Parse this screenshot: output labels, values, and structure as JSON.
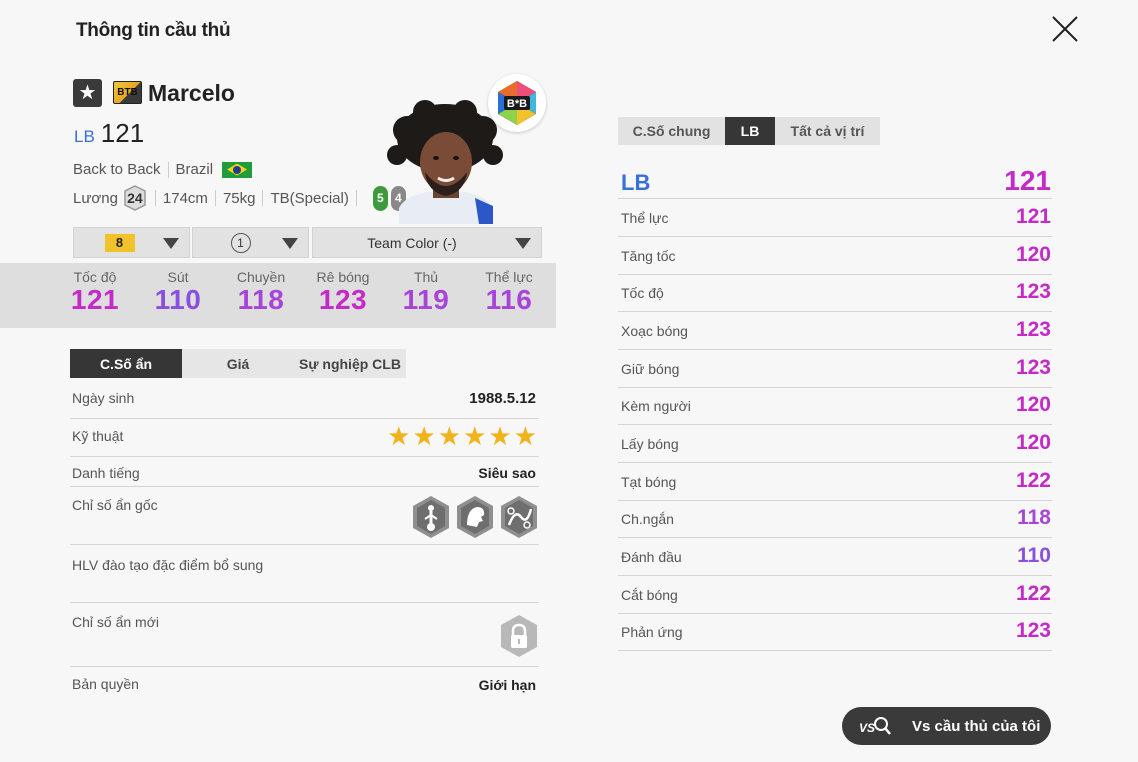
{
  "header": {
    "title": "Thông tin cầu thủ"
  },
  "player": {
    "season_code": "BTB",
    "name": "Marcelo",
    "position": "LB",
    "ovr": "121",
    "season_name": "Back to Back",
    "nationality": "Brazil",
    "salary_label": "Lương",
    "salary": "24",
    "height": "174cm",
    "weight": "75kg",
    "body_type": "TB(Special)",
    "left_foot": "5",
    "right_foot": "4"
  },
  "controls": {
    "grade": "8",
    "level": "1",
    "team_color": "Team Color (-)"
  },
  "main_stats": [
    {
      "label": "Tốc độ",
      "value": "121"
    },
    {
      "label": "Sút",
      "value": "110"
    },
    {
      "label": "Chuyền",
      "value": "118"
    },
    {
      "label": "Rê bóng",
      "value": "123"
    },
    {
      "label": "Thủ",
      "value": "119"
    },
    {
      "label": "Thể lực",
      "value": "116"
    }
  ],
  "left_tabs": [
    "C.Số ẩn",
    "Giá",
    "Sự nghiệp CLB"
  ],
  "info": {
    "birth_label": "Ngày sinh",
    "birth": "1988.5.12",
    "skill_label": "Kỹ thuật",
    "skill_stars": 6,
    "reputation_label": "Danh tiếng",
    "reputation": "Siêu sao",
    "traits_label": "Chỉ số ẩn gốc",
    "traits": [
      "long-throw-icon",
      "team-player-icon",
      "flair-icon"
    ],
    "coach_label": "HLV đào tạo đặc điểm bổ sung",
    "new_traits_label": "Chỉ số ẩn mới",
    "license_label": "Bản quyền",
    "license": "Giới hạn"
  },
  "right_tabs": [
    "C.Số chung",
    "LB",
    "Tất cả vị trí"
  ],
  "position_rating": {
    "label": "LB",
    "value": "121"
  },
  "detail_stats": [
    {
      "label": "Thể lực",
      "value": "121"
    },
    {
      "label": "Tăng tốc",
      "value": "120"
    },
    {
      "label": "Tốc độ",
      "value": "123"
    },
    {
      "label": "Xoạc bóng",
      "value": "123"
    },
    {
      "label": "Giữ bóng",
      "value": "123"
    },
    {
      "label": "Kèm người",
      "value": "120"
    },
    {
      "label": "Lấy bóng",
      "value": "120"
    },
    {
      "label": "Tạt bóng",
      "value": "122"
    },
    {
      "label": "Ch.ngắn",
      "value": "118"
    },
    {
      "label": "Đánh đầu",
      "value": "110"
    },
    {
      "label": "Cắt bóng",
      "value": "122"
    },
    {
      "label": "Phản ứng",
      "value": "123"
    }
  ],
  "vs_button": {
    "label": "Vs cầu thủ của tôi"
  },
  "colors": {
    "stat_high": "#c42ac8",
    "stat_mid": "#a845d8",
    "stat_low": "#8a4fe0",
    "position_blue": "#3b6fd8"
  }
}
